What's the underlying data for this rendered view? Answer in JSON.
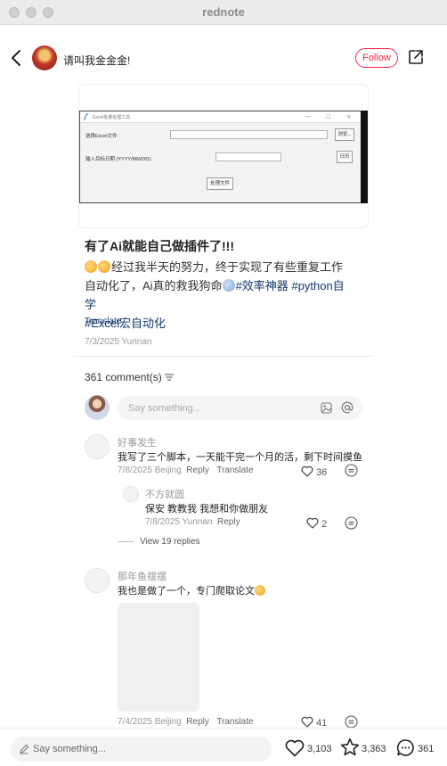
{
  "window": {
    "title": "rednote"
  },
  "header": {
    "author": "请叫我金金金!",
    "follow_label": "Follow"
  },
  "image_window": {
    "title": "Excel批量处理工具",
    "controls": [
      "—",
      "☐",
      "✕"
    ],
    "label_file": "选择Excel文件:",
    "label_date": "输入目标日期 (YYYY/MM/DD):",
    "browse_label": "浏览...",
    "calendar_label": "日历",
    "process_label": "处理文件"
  },
  "post": {
    "title": "有了Ai就能自己做插件了!!!",
    "body_text": "经过我半天的努力，终于实现了有些重复工作自动化了，Ai真的救我狗命",
    "tags": [
      "#效率神器",
      "#python自学",
      "#Excel宏自动化"
    ],
    "translate": "Translate",
    "date_location": "7/3/2025 Yunnan"
  },
  "comments_section": {
    "count_label": "361 comment(s)",
    "placeholder": "Say something..."
  },
  "comments": [
    {
      "name": "好事发生",
      "text": "我写了三个脚本，一天能干完一个月的活，剩下时间摸鱼",
      "date_location": "7/8/2025 Beijing",
      "reply": "Reply",
      "translate": "Translate",
      "likes": "36"
    },
    {
      "name": "那年鱼摆摆",
      "text": "我也是做了一个，专门爬取论文",
      "date_location": "7/4/2025 Beijing",
      "reply": "Reply",
      "translate": "Translate",
      "likes": "41"
    }
  ],
  "reply": {
    "name": "不方就圆",
    "text": "保安  教教我 我想和你做朋友",
    "date_location": "7/8/2025 Yunnan",
    "reply": "Reply",
    "likes": "2"
  },
  "view_replies": "View 19 replies",
  "bottom_bar": {
    "placeholder": "Say something...",
    "likes": "3,103",
    "collects": "3,363",
    "comments": "361"
  }
}
